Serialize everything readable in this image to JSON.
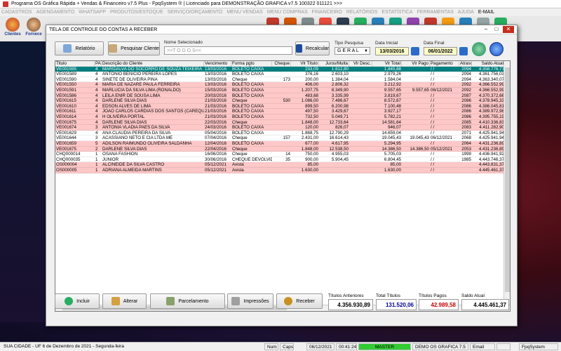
{
  "titlebar": {
    "title": "Programa OS Gráfica Rápida + Vendas & Financeiro v7.5 Plus - FpqSystem ® | Licenciado para  DEMONSTRAÇÃO GRAFICA v7.5 100322 011121 >>>"
  },
  "menu": [
    "CADASTROS",
    "AGENDAMENTO",
    "WHATSAPP",
    "PRODUTOS/ESTOQUE",
    "SERVIÇO/ORÇAMENTO",
    "MENU VENDAS",
    "MENU COMPRAS",
    "FINANCEIRO",
    "RELATÓRIOS",
    "ESTATÍSTICA",
    "FERRAMENTAS",
    "AJUDA",
    "E-MAIL"
  ],
  "quick": {
    "clientes": "Clientes",
    "fornecedores": "Fornece"
  },
  "window": {
    "title": "TELA DE CONTROLE DO CONTAS A RECEBER",
    "relatorio": "Relatório",
    "pesquisar": "Pesquisar Cliente",
    "nome_label": "Nome Selecionado",
    "nome_value": ">>T O D O S<<",
    "recalcular": "Recalcular",
    "tipo_label": "Tipo Pesquisa",
    "tipo_value": "G E R A L",
    "data_inicial_label": "Data Inicial",
    "data_inicial": "13/03/2016",
    "data_final_label": "Data Final",
    "data_final": "06/01/2022"
  },
  "table": {
    "headers": [
      "Titulo",
      "PA",
      "Descrição do Cliente",
      "Vencimento",
      "Forma pgto",
      "Cheque",
      "Vlr Título",
      "Juros/Multa",
      "Vlr Desc.",
      "Vlr Total",
      "Vlr Pago",
      "Pagamento",
      "Atraso",
      "Saldo Atual"
    ],
    "rows": [
      [
        "VE001595",
        "4",
        "MARIDALVA DO SOCORRO DE SOUZA TEIXEIRA",
        "13/03/2016",
        "BOLETO CAIXA",
        "",
        "233,09",
        "1.612,80",
        "",
        "1.845,88",
        "",
        "/ /",
        "2094",
        "4.358.776,77"
      ],
      [
        "VE001589",
        "4",
        "ANTONIO BENICIO PEREIRA LOPES",
        "13/03/2016",
        "BOLETO CAIXA",
        "",
        "376,16",
        "2.603,10",
        "",
        "2.979,26",
        "",
        "/ /",
        "2094",
        "4.361.756,03"
      ],
      [
        "VE001590",
        "4",
        "SINETE DE OLIVEIRA PINA",
        "13/03/2016",
        "Cheque",
        "173",
        "200,00",
        "1.384,04",
        "",
        "1.584,04",
        "",
        "/ /",
        "2094",
        "4.363.340,07"
      ],
      [
        "VE001550",
        "4",
        "MARIA DE NAZARE PAULA FERREIRA",
        "13/03/2016",
        "BOLETO CAIXA",
        "",
        "406,00",
        "2.806,32",
        "",
        "3.212,92",
        "",
        "/ /",
        "2092",
        "4.366.552,99"
      ],
      [
        "VE001591",
        "4",
        "MARLUCIA DA SILVA LIMA  (RONALDO)",
        "15/03/2016",
        "BOLETO CAIXA",
        "",
        "1.207,75",
        "8.349,90",
        "",
        "9.557,65",
        "9.557,65",
        "06/12/2021",
        "2092",
        "4.366.552,99"
      ],
      [
        "VE001586",
        "4",
        "LEILA ENIR DE SOUSA LIMA",
        "20/03/2016",
        "BOLETO CAIXA",
        "",
        "483,68",
        "3.335,99",
        "",
        "3.819,67",
        "",
        "/ /",
        "2087",
        "4.370.372,66"
      ],
      [
        "VE001615",
        "4",
        "DARLENE SILVA DIAS",
        "21/03/2016",
        "Cheque",
        "530",
        "1.086,00",
        "7.486,67",
        "",
        "8.572,67",
        "",
        "/ /",
        "2086",
        "4.378.945,33"
      ],
      [
        "VE001610",
        "4",
        "EDSON ALVES DE LIMA",
        "21/03/2016",
        "BOLETO CAIXA",
        "",
        "899,50",
        "6.200,98",
        "",
        "7.100,48",
        "",
        "/ /",
        "2086",
        "4.386.045,81"
      ],
      [
        "VE001611",
        "4",
        "JOÃO CARLOS CARDIAS DOS SANTOS (CAREQUIN",
        "21/03/2016",
        "BOLETO CAIXA",
        "",
        "497,50",
        "3.429,67",
        "",
        "3.927,17",
        "",
        "/ /",
        "2086",
        "4.389.972,98"
      ],
      [
        "VE001614",
        "4",
        "H OLIVEIRA PORTAL",
        "21/03/2016",
        "BOLETO CAIXA",
        "",
        "732,50",
        "5.049,71",
        "",
        "5.782,21",
        "",
        "/ /",
        "2086",
        "4.395.755,19"
      ],
      [
        "VE001675",
        "4",
        "DARLENE SILVA DIAS",
        "22/03/2016",
        "Cheque",
        "",
        "1.848,00",
        "12.733,64",
        "",
        "14.581,64",
        "",
        "/ /",
        "2085",
        "4.410.336,83"
      ],
      [
        "VE001674",
        "3",
        "ANTONIA VLADIA PAES DA SILVA",
        "24/03/2016",
        "BOLETO CAIXA",
        "",
        "120,00",
        "826,07",
        "",
        "946,07",
        "",
        "/ /",
        "2083",
        "4.411.282,90"
      ],
      [
        "VE001629",
        "4",
        "ANA CLAUDIA PEREIRA DA SILVA",
        "05/04/2016",
        "BOLETO CAIXA",
        "",
        "1.868,75",
        "12.790,29",
        "",
        "14.659,04",
        "",
        "/ /",
        "2071",
        "4.425.941,94"
      ],
      [
        "VE001644",
        "3",
        "ACASSIANO NETO E CIA LTDA ME",
        "07/04/2016",
        "Cheque",
        "157",
        "2.431,00",
        "16.614,43",
        "",
        "19.045,43",
        "19.045,43",
        "06/12/2021",
        "2068",
        "4.425.941,94"
      ],
      [
        "VE001659",
        "5",
        "ADILSON RAIMUNDO OLIVEIRA SALDANHA",
        "12/04/2016",
        "BOLETO CAIXA",
        "",
        "677,00",
        "4.617,95",
        "",
        "5.294,95",
        "",
        "/ /",
        "2064",
        "4.431.236,89"
      ],
      [
        "VE001675",
        "2",
        "DARLENE SILVA DIAS",
        "22/04/2016",
        "Cheque",
        "",
        "1.848,00",
        "12.538,50",
        "",
        "14.386,50",
        "14.386,50",
        "05/12/2021",
        "2053",
        "4.431.236,89"
      ],
      [
        "CHQ000014",
        "1",
        "OSANA FASHION",
        "16/06/2016",
        "Cheque",
        "14",
        "750,00",
        "4.955,03",
        "",
        "5.705,03",
        "",
        "/ /",
        "1999",
        "4.436.941,92"
      ],
      [
        "CHQ000035",
        "1",
        "JUNIOR",
        "30/06/2016",
        "CHEQUE DEVOLVIDO",
        "35",
        "900,00",
        "5.904,45",
        "",
        "6.804,45",
        "",
        "/ /",
        "1985",
        "4.443.746,37"
      ],
      [
        "OS000004",
        "1",
        "ALCINEIDE DA SILVA CASTRO",
        "05/12/2021",
        "Avista",
        "",
        "85,00",
        "",
        "",
        "85,00",
        "",
        "/ /",
        "",
        "4.443.831,37"
      ],
      [
        "OS000005",
        "1",
        "ADRIANA ALMEIDA MARTINS",
        "05/12/2021",
        "Avista",
        "",
        "1.630,00",
        "",
        "",
        "1.630,00",
        "",
        "/ /",
        "",
        "4.445.461,37"
      ]
    ]
  },
  "actions": {
    "incluir": "Incluir",
    "alterar": "Alterar",
    "parcelamento": "Parcelamento",
    "impressoes": "Impressões",
    "receber": "Receber"
  },
  "totals": {
    "anteriores_label": "Títulos Anteriores",
    "anteriores": "4.356.930,89",
    "titulos_label": "Total Títulos",
    "titulos": "131.520,06",
    "pagos_label": "Títulos Pagos",
    "pagos": "42.989,58",
    "saldo_label": "Saldo Atual",
    "saldo": "4.445.461,37"
  },
  "statusbar": {
    "cidade": "SUA CIDADE - UF  6 de Dezembro de 2021 - Segunda-feira",
    "num": "Num",
    "caps": "Caps",
    "date": "06/12/2021",
    "time": "00:41:24",
    "master": "MASTER",
    "demo": "DEMO OS GRAFICA 7.5",
    "email": "Email",
    "fpq": "FpqSystem"
  },
  "colors": {
    "pink_row": "#ffc8c8",
    "white_row": "#ffffff",
    "selected_row": "#008080",
    "master_green": "#33cc33",
    "pagos_red": "#c80000",
    "titulos_blue": "#0000a0"
  }
}
